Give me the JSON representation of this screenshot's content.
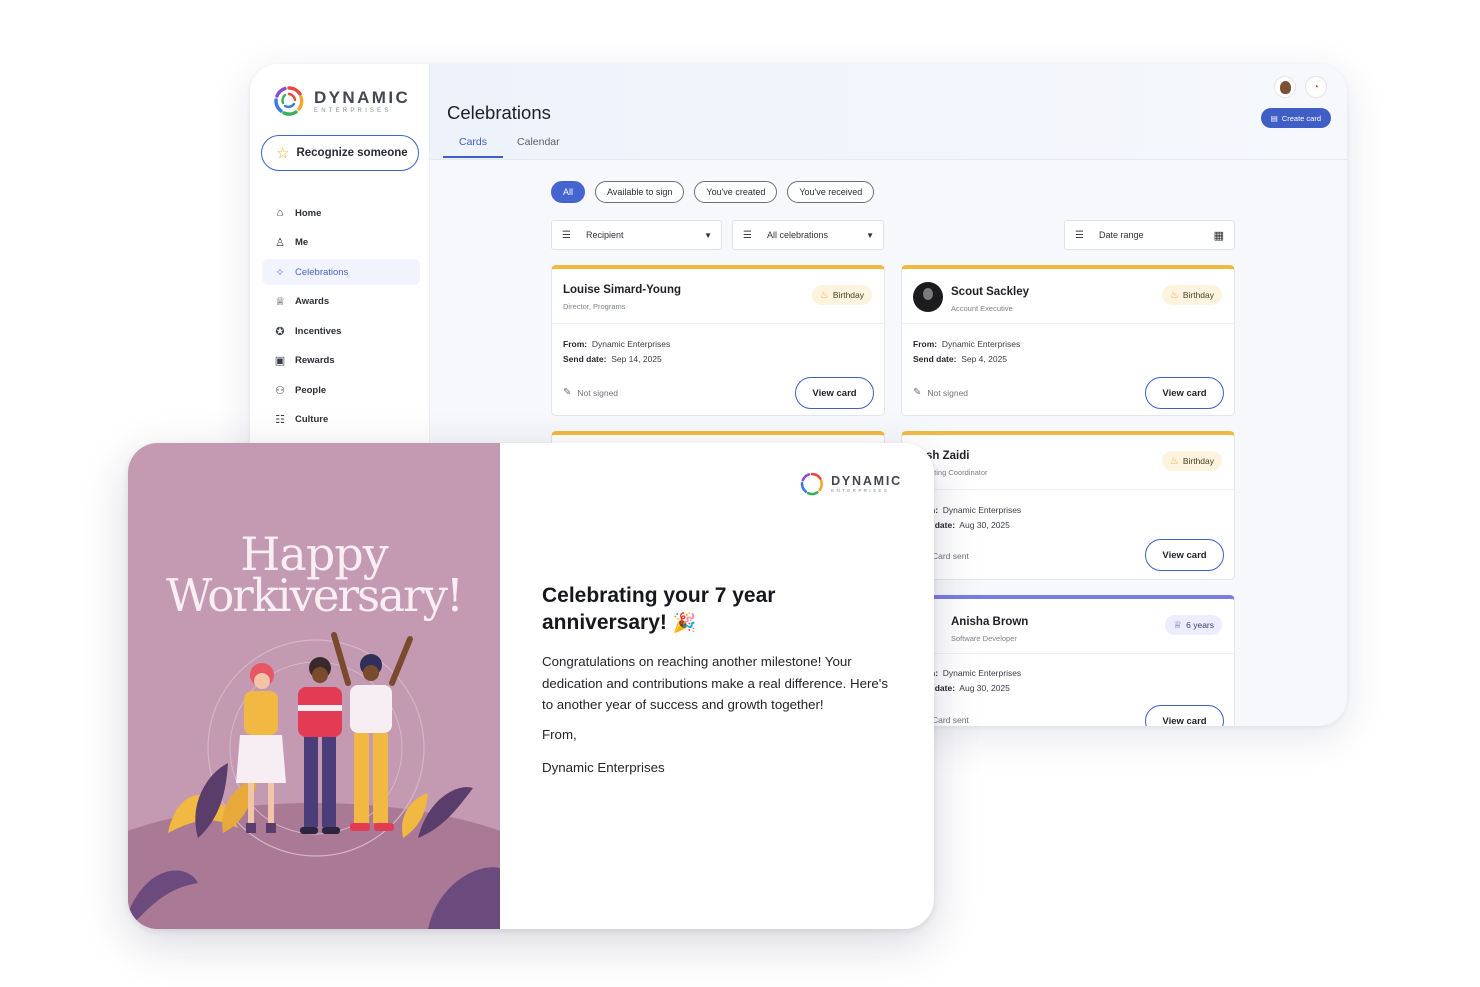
{
  "brand": {
    "name": "DYNAMIC",
    "sub": "ENTERPRISES"
  },
  "sidebar": {
    "recognize_label": "Recognize someone",
    "items": [
      {
        "label": "Home",
        "icon": "home-icon"
      },
      {
        "label": "Me",
        "icon": "person-icon"
      },
      {
        "label": "Celebrations",
        "icon": "party-popper-icon",
        "active": true
      },
      {
        "label": "Awards",
        "icon": "trophy-icon"
      },
      {
        "label": "Incentives",
        "icon": "incentive-icon"
      },
      {
        "label": "Rewards",
        "icon": "gift-icon"
      },
      {
        "label": "People",
        "icon": "people-icon"
      },
      {
        "label": "Culture",
        "icon": "culture-icon"
      }
    ]
  },
  "header": {
    "title": "Celebrations",
    "tabs": [
      "Cards",
      "Calendar"
    ],
    "active_tab": "Cards",
    "create_label": "Create card"
  },
  "filters": {
    "chips": [
      "All",
      "Available to sign",
      "You've created",
      "You've received"
    ],
    "active_chip": "All",
    "recipient": "Recipient",
    "celebrations": "All celebrations",
    "date_range": "Date range"
  },
  "cards": [
    {
      "name": "Louise Simard-Young",
      "role": "Director, Programs",
      "badge": "Birthday",
      "from_label": "From:",
      "from": "Dynamic Enterprises",
      "date_label": "Send date:",
      "date": "Sep 14, 2025",
      "status": "Not signed",
      "button": "View card"
    },
    {
      "name": "Scout Sackley",
      "role": "Account Executive",
      "badge": "Birthday",
      "from_label": "From:",
      "from": "Dynamic Enterprises",
      "date_label": "Send date:",
      "date": "Sep 4, 2025",
      "status": "Not signed",
      "button": "View card"
    },
    {
      "name": "sh Zaidi",
      "role": "eting Coordinator",
      "badge": "Birthday",
      "from_label": "n:",
      "from": "Dynamic Enterprises",
      "date_label": "l date:",
      "date": "Aug 30, 2025",
      "status": "Card sent",
      "button": "View card"
    },
    {
      "name": "Anisha Brown",
      "role": "Software Developer",
      "badge": "6 years",
      "from_label": "n:",
      "from": "Dynamic Enterprises",
      "date_label": "l date:",
      "date": "Aug 30, 2025",
      "status": "Card sent",
      "button": "View card"
    }
  ],
  "ecard": {
    "headline_1": "Happy",
    "headline_2": "Workiversary!",
    "title": "Celebrating your 7 year anniversary!",
    "party_emoji": "🎉",
    "message": "Congratulations on reaching another milestone! Your dedication and contributions make a real difference. Here's to another year of success and growth together!",
    "from": "From,",
    "signature": "Dynamic Enterprises"
  },
  "colors": {
    "accent": "#3f5fc6",
    "birthday": "#f1b942",
    "anniversary": "#7c7be0",
    "ecard_bg": "#c39ab1"
  }
}
